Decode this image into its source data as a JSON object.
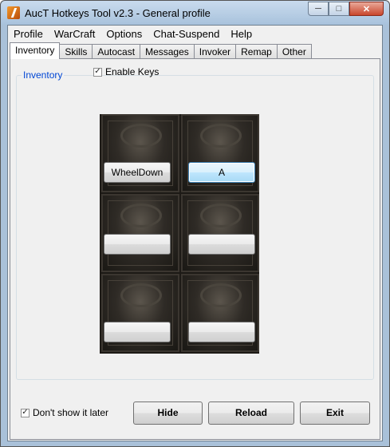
{
  "window": {
    "title": "AucT Hotkeys Tool v2.3 - General profile"
  },
  "menu": [
    "Profile",
    "WarCraft",
    "Options",
    "Chat-Suspend",
    "Help"
  ],
  "tabs": [
    "Inventory",
    "Skills",
    "Autocast",
    "Messages",
    "Invoker",
    "Remap",
    "Other"
  ],
  "active_tab": "Inventory",
  "inventory": {
    "group_title": "Inventory",
    "enable_keys_label": "Enable Keys",
    "enable_keys_checked": true,
    "slots": [
      "WheelDown",
      "A",
      "",
      "",
      "",
      ""
    ]
  },
  "footer": {
    "dont_show_label": "Don't show it later",
    "dont_show_checked": true,
    "hide_label": "Hide",
    "reload_label": "Reload",
    "exit_label": "Exit"
  },
  "icons": {
    "app": "app-icon",
    "minimize": "minimize-icon",
    "maximize": "maximize-icon",
    "close": "close-icon",
    "check": "check-icon"
  }
}
